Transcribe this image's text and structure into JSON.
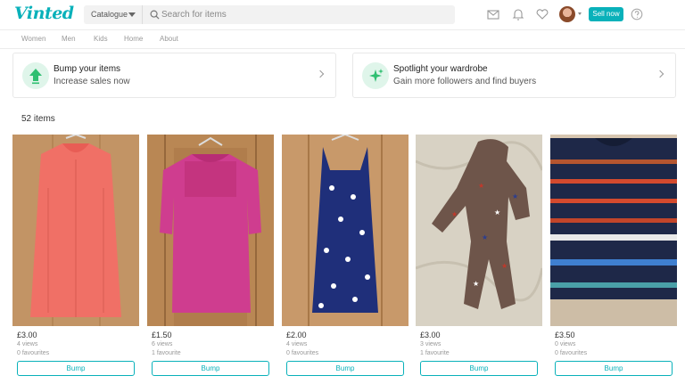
{
  "header": {
    "logo": "Vinted",
    "catalogue_label": "Catalogue",
    "search_placeholder": "Search for items",
    "sell_label": "Sell now",
    "icons": [
      "mail-icon",
      "bell-icon",
      "heart-icon",
      "avatar",
      "help-icon"
    ]
  },
  "nav": {
    "items": [
      {
        "label": "Women"
      },
      {
        "label": "Men"
      },
      {
        "label": "Kids"
      },
      {
        "label": "Home"
      },
      {
        "label": "About"
      }
    ]
  },
  "promos": [
    {
      "title": "Bump your items",
      "subtitle": "Increase sales now",
      "icon": "bump-arrow-icon"
    },
    {
      "title": "Spotlight your wardrobe",
      "subtitle": "Gain more followers and find buyers",
      "icon": "sparkle-icon"
    }
  ],
  "item_count": "52 items",
  "items": [
    {
      "price": "£3.00",
      "views": "4 views",
      "favourites": "0 favourites",
      "button": "Bump",
      "garment": "coral sleeveless top"
    },
    {
      "price": "£1.50",
      "views": "6 views",
      "favourites": "1 favourite",
      "button": "Bump",
      "garment": "pink cold-shoulder top"
    },
    {
      "price": "£2.00",
      "views": "4 views",
      "favourites": "0 favourites",
      "button": "Bump",
      "garment": "navy floral dress"
    },
    {
      "price": "£3.00",
      "views": "3 views",
      "favourites": "1 favourite",
      "button": "Bump",
      "garment": "star print romper"
    },
    {
      "price": "£3.50",
      "views": "0 views",
      "favourites": "0 favourites",
      "button": "Bump",
      "garment": "navy striped jumper"
    }
  ],
  "colors": {
    "accent": "#09b1ba",
    "promo_icon_bg": "#dff5ea",
    "promo_icon_fg": "#2fbf71"
  }
}
